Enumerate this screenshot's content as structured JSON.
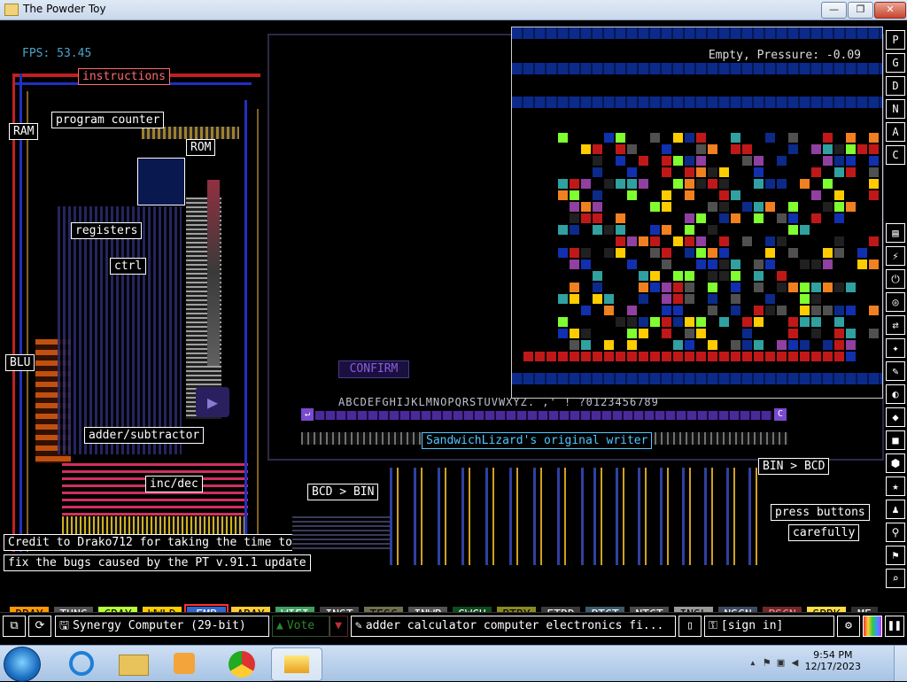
{
  "window": {
    "title": "The Powder Toy",
    "min_label": "—",
    "max_label": "❐",
    "close_label": "✕"
  },
  "hud": {
    "fps": "FPS: 53.45",
    "status": "Empty, Pressure: -0.09"
  },
  "labels": {
    "instructions": "instructions",
    "program_counter": "program counter",
    "ram": "RAM",
    "rom": "ROM",
    "registers": "registers",
    "ctrl": "ctrl",
    "blu": "BLU",
    "adder_subtractor": "adder/subtractor",
    "inc_dec": "inc/dec",
    "credit_line1": "Credit to Drako712 for taking the time to",
    "credit_line2": "fix the bugs caused by the PT v.91.1 update",
    "confirm": "CONFIRM",
    "alphabet": "ABCDEFGHIJKLMNOPQRSTUVWXYZ. ,' ! ?0123456789",
    "original_writer": "SandwichLizard's original writer",
    "bcd_to_bin": "BCD > BIN",
    "bin_to_bcd": "BIN > BCD",
    "press_buttons": "press buttons",
    "carefully": "carefully",
    "left_arrow": "↵",
    "c_key": "C"
  },
  "tools_top": [
    "P",
    "G",
    "D",
    "N",
    "A",
    "C"
  ],
  "tools_lower": [
    "▤",
    "⚡",
    "⏻",
    "◎",
    "⇄",
    "✦",
    "✎",
    "◐",
    "◆",
    "■",
    "⬢",
    "★",
    "♟",
    "⚲",
    "⚑",
    "⌕"
  ],
  "elements": [
    {
      "label": "DRAY",
      "bg": "#ff9900",
      "fg": "#000000"
    },
    {
      "label": "TUNG",
      "bg": "#505050",
      "fg": "#ffffff"
    },
    {
      "label": "CRAY",
      "bg": "#b6ff3a",
      "fg": "#000000"
    },
    {
      "label": "WWLD",
      "bg": "#ffcc00",
      "fg": "#000000"
    },
    {
      "label": "EMP",
      "bg": "#3366cc",
      "fg": "#ffffff",
      "selected": true
    },
    {
      "label": "ARAY",
      "bg": "#ffcc33",
      "fg": "#000000"
    },
    {
      "label": "WIFI",
      "bg": "#40a060",
      "fg": "#ffffff"
    },
    {
      "label": "INST",
      "bg": "#404040",
      "fg": "#ffffff"
    },
    {
      "label": "TESC",
      "bg": "#707050",
      "fg": "#000000"
    },
    {
      "label": "INWR",
      "bg": "#545454",
      "fg": "#ffffff"
    },
    {
      "label": "SWCH",
      "bg": "#0e4d1e",
      "fg": "#ffffff"
    },
    {
      "label": "BTRY",
      "bg": "#8a8a22",
      "fg": "#000000"
    },
    {
      "label": "ETRD",
      "bg": "#3a3a3a",
      "fg": "#ffffff"
    },
    {
      "label": "PTCT",
      "bg": "#3d5a6a",
      "fg": "#ffffff"
    },
    {
      "label": "NTCT",
      "bg": "#4a4a4a",
      "fg": "#ffffff"
    },
    {
      "label": "INSL",
      "bg": "#9a9a9a",
      "fg": "#000000"
    },
    {
      "label": "NSCN",
      "bg": "#404a60",
      "fg": "#ffffff"
    },
    {
      "label": "PSCN",
      "bg": "#702828",
      "fg": "#ff9090"
    },
    {
      "label": "SPRK",
      "bg": "#ffdd44",
      "fg": "#000000"
    },
    {
      "label": "ME",
      "bg": "#303030",
      "fg": "#ffffff"
    }
  ],
  "bottombar": {
    "save_name": "Synergy Computer (29-bit)",
    "vote": "Vote",
    "tags": "adder calculator computer electronics fi...",
    "sign_in": "[sign in]"
  },
  "taskbar": {
    "time": "9:54 PM",
    "date": "12/17/2023"
  },
  "colors": {
    "accent_blue": "#0b2a8a",
    "label_red": "#ff6b6b",
    "label_cyan": "#50c8ff",
    "fps_color": "#4aa3c9",
    "confirm_color": "#8a5cd6"
  }
}
